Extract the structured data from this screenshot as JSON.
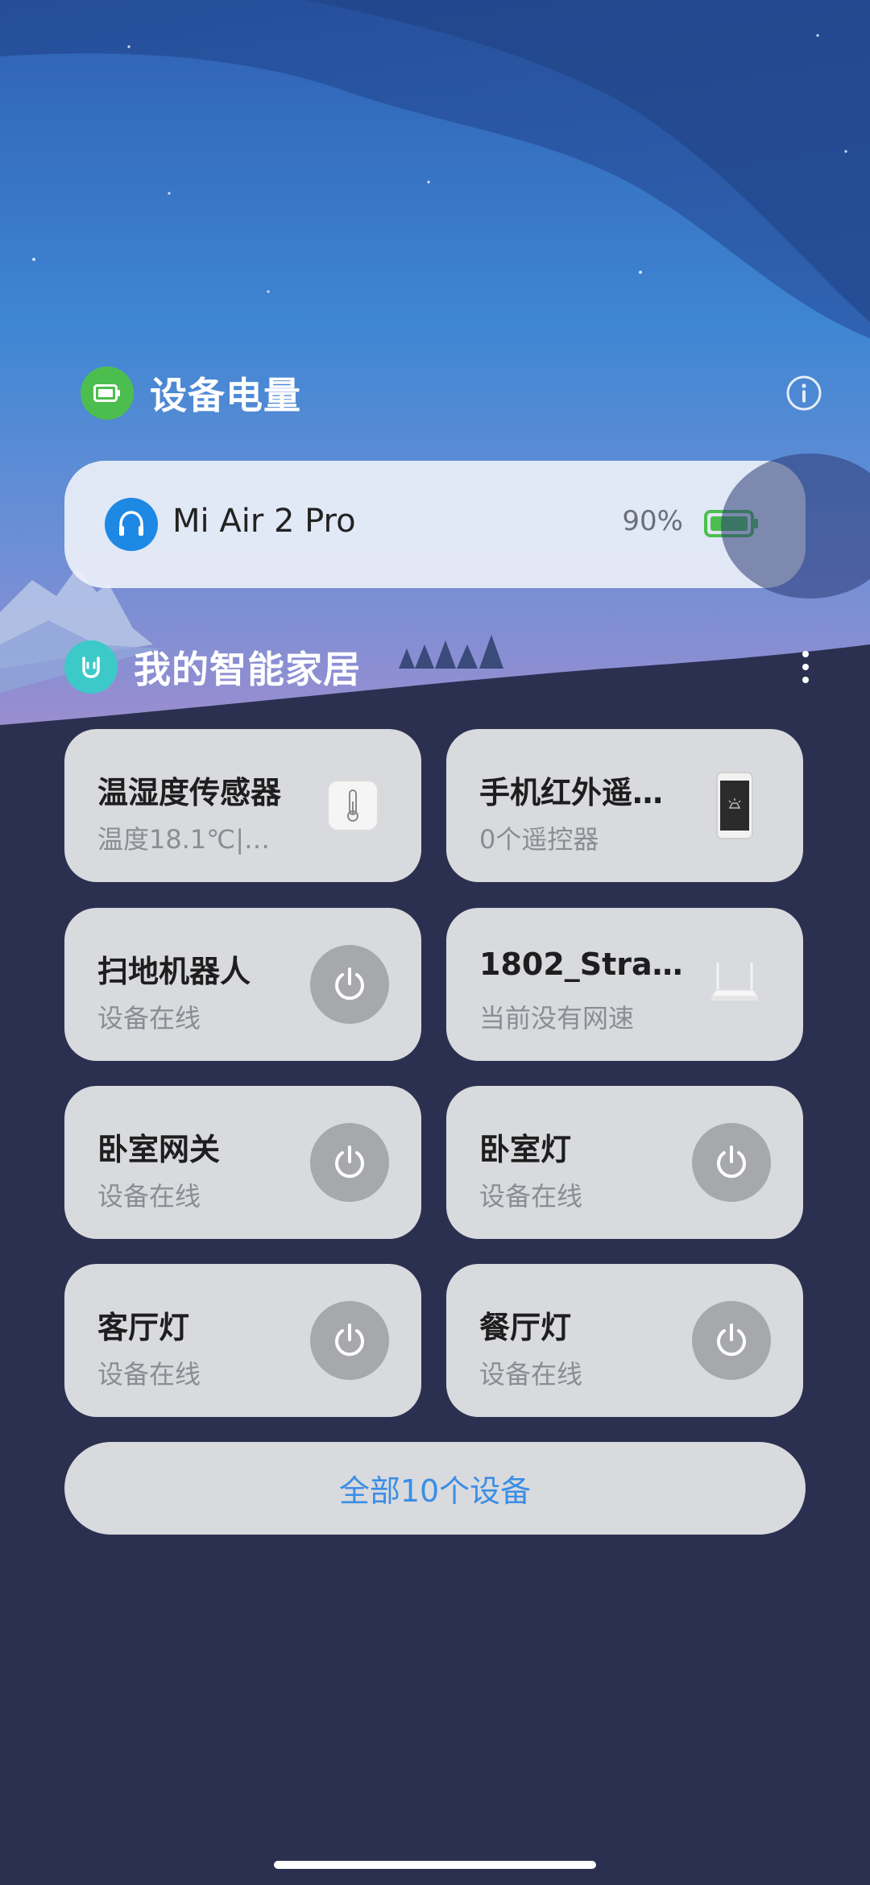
{
  "battery_section": {
    "title": "设备电量",
    "device": {
      "name": "Mi Air 2 Pro",
      "percent": "90%",
      "level": 0.9
    }
  },
  "home_section": {
    "title": "我的智能家居",
    "devices": [
      {
        "name": "温湿度传感器",
        "status": "温度18.1℃|…",
        "icon": "thermometer-icon"
      },
      {
        "name": "手机红外遥…",
        "status": "0个遥控器",
        "icon": "phone-remote-icon"
      },
      {
        "name": "扫地机器人",
        "status": "设备在线",
        "icon": "power-icon"
      },
      {
        "name": "1802_Stra…",
        "status": "当前没有网速",
        "icon": "router-icon"
      },
      {
        "name": "卧室网关",
        "status": "设备在线",
        "icon": "power-icon"
      },
      {
        "name": "卧室灯",
        "status": "设备在线",
        "icon": "power-icon"
      },
      {
        "name": "客厅灯",
        "status": "设备在线",
        "icon": "power-icon"
      },
      {
        "name": "餐厅灯",
        "status": "设备在线",
        "icon": "power-icon"
      }
    ],
    "all_devices_label": "全部10个设备"
  },
  "colors": {
    "battery_green": "#4cbe4f",
    "link_blue": "#3a8ee6",
    "headphone_blue": "#1e88e5",
    "home_teal": "#3ec9c9"
  }
}
